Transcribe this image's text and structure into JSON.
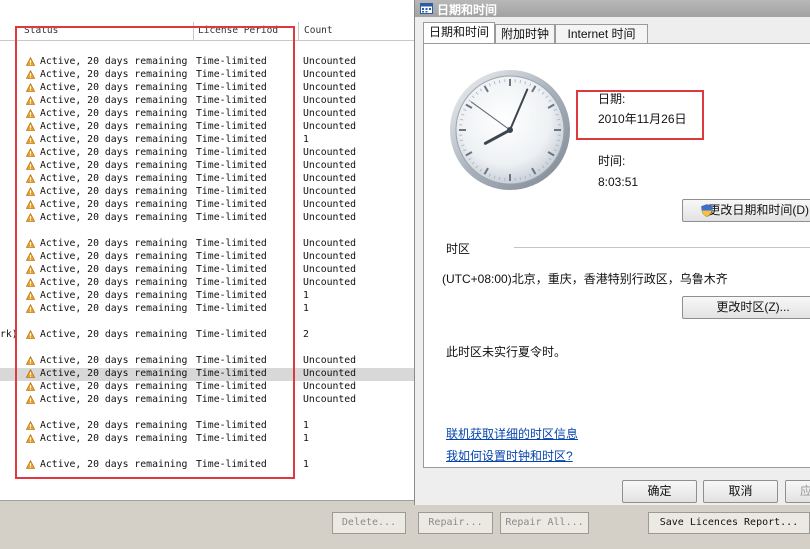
{
  "license_list": {
    "columns": [
      "Status",
      "License Period",
      "Count"
    ],
    "rows": [
      {
        "status": "Active, 20 days remaining",
        "period": "Time-limited",
        "count": "Uncounted"
      },
      {
        "status": "Active, 20 days remaining",
        "period": "Time-limited",
        "count": "Uncounted"
      },
      {
        "status": "Active, 20 days remaining",
        "period": "Time-limited",
        "count": "Uncounted"
      },
      {
        "status": "Active, 20 days remaining",
        "period": "Time-limited",
        "count": "Uncounted"
      },
      {
        "status": "Active, 20 days remaining",
        "period": "Time-limited",
        "count": "Uncounted"
      },
      {
        "status": "Active, 20 days remaining",
        "period": "Time-limited",
        "count": "Uncounted"
      },
      {
        "status": "Active, 20 days remaining",
        "period": "Time-limited",
        "count": "1"
      },
      {
        "status": "Active, 20 days remaining",
        "period": "Time-limited",
        "count": "Uncounted"
      },
      {
        "status": "Active, 20 days remaining",
        "period": "Time-limited",
        "count": "Uncounted"
      },
      {
        "status": "Active, 20 days remaining",
        "period": "Time-limited",
        "count": "Uncounted"
      },
      {
        "status": "Active, 20 days remaining",
        "period": "Time-limited",
        "count": "Uncounted"
      },
      {
        "status": "Active, 20 days remaining",
        "period": "Time-limited",
        "count": "Uncounted"
      },
      {
        "status": "Active, 20 days remaining",
        "period": "Time-limited",
        "count": "Uncounted"
      },
      {
        "status": "Active, 20 days remaining",
        "period": "Time-limited",
        "count": "Uncounted"
      },
      {
        "status": "Active, 20 days remaining",
        "period": "Time-limited",
        "count": "Uncounted"
      },
      {
        "status": "Active, 20 days remaining",
        "period": "Time-limited",
        "count": "Uncounted"
      },
      {
        "status": "Active, 20 days remaining",
        "period": "Time-limited",
        "count": "Uncounted"
      },
      {
        "status": "Active, 20 days remaining",
        "period": "Time-limited",
        "count": "1"
      },
      {
        "status": "Active, 20 days remaining",
        "period": "Time-limited",
        "count": "1"
      },
      {
        "prefix": "rk)",
        "status": "Active, 20 days remaining",
        "period": "Time-limited",
        "count": "2"
      },
      {
        "status": "Active, 20 days remaining",
        "period": "Time-limited",
        "count": "Uncounted"
      },
      {
        "status": "Active, 20 days remaining",
        "period": "Time-limited",
        "count": "Uncounted",
        "selected": true
      },
      {
        "status": "Active, 20 days remaining",
        "period": "Time-limited",
        "count": "Uncounted"
      },
      {
        "status": "Active, 20 days remaining",
        "period": "Time-limited",
        "count": "Uncounted"
      },
      {
        "status": "Active, 20 days remaining",
        "period": "Time-limited",
        "count": "1"
      },
      {
        "status": "Active, 20 days remaining",
        "period": "Time-limited",
        "count": "1"
      },
      {
        "status": "Active, 20 days remaining",
        "period": "Time-limited",
        "count": "1"
      }
    ],
    "buttons": {
      "delete": "Delete...",
      "repair": "Repair...",
      "repair_all": "Repair All...",
      "save_report": "Save Licences Report..."
    }
  },
  "dialog": {
    "title": "日期和时间",
    "tabs": [
      "日期和时间",
      "附加时钟",
      "Internet 时间"
    ],
    "date_label": "日期:",
    "date_value": "2010年11月26日",
    "time_label": "时间:",
    "time_value": "8:03:51",
    "change_datetime_button": "更改日期和时间(D)...",
    "timezone_label": "时区",
    "timezone_value": "(UTC+08:00)北京，重庆，香港特别行政区，乌鲁木齐",
    "change_timezone_button": "更改时区(Z)...",
    "dst_note": "此时区未实行夏令时。",
    "link_timezone_info": "联机获取详细的时区信息",
    "link_how_to": "我如何设置时钟和时区?",
    "ok_button": "确定",
    "cancel_button": "取消",
    "apply_button": "应"
  },
  "colors": {
    "highlight_box": "#e0383f",
    "warning_icon": "#f0a020",
    "link": "#0645ad"
  },
  "icons": {
    "row_status": "warning-triangle-icon",
    "dialog_title": "calendar-icon",
    "change_datetime": "uac-shield-icon",
    "clock": "analog-clock"
  }
}
